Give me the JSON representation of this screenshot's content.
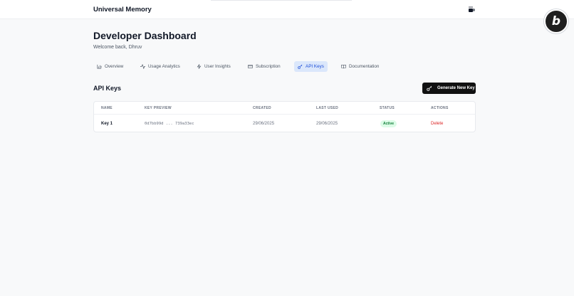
{
  "header": {
    "app_title": "Universal Memory",
    "top_icon": "cup-icon"
  },
  "badge": {
    "letter": "b",
    "icon": "badge-icon"
  },
  "page": {
    "title": "Developer Dashboard",
    "welcome": "Welcome back, Dhruv"
  },
  "tabs": [
    {
      "label": "Overview",
      "icon": "bar-chart-icon",
      "active": false
    },
    {
      "label": "Usage Analytics",
      "icon": "activity-icon",
      "active": false
    },
    {
      "label": "User Insights",
      "icon": "zap-icon",
      "active": false
    },
    {
      "label": "Subscription",
      "icon": "credit-card-icon",
      "active": false
    },
    {
      "label": "API Keys",
      "icon": "key-icon",
      "active": true
    },
    {
      "label": "Documentation",
      "icon": "book-icon",
      "active": false
    }
  ],
  "api_keys": {
    "section_title": "API Keys",
    "generate_label": "Generate New Key",
    "columns": [
      "NAME",
      "KEY PREVIEW",
      "CREATED",
      "LAST USED",
      "STATUS",
      "ACTIONS"
    ],
    "rows": [
      {
        "name": "Key 1",
        "key_preview": "0d7bb99d ... 739a33ec",
        "created": "29/06/2025",
        "last_used": "29/06/2025",
        "status": "Active",
        "action": "Delete"
      }
    ]
  },
  "colors": {
    "accent_tab_bg": "#dbe7fb",
    "accent_tab_text": "#1d4ed8",
    "status_active_bg": "#dcfce7",
    "status_active_text": "#15803d",
    "danger": "#dc2626",
    "button_bg": "#111111"
  }
}
